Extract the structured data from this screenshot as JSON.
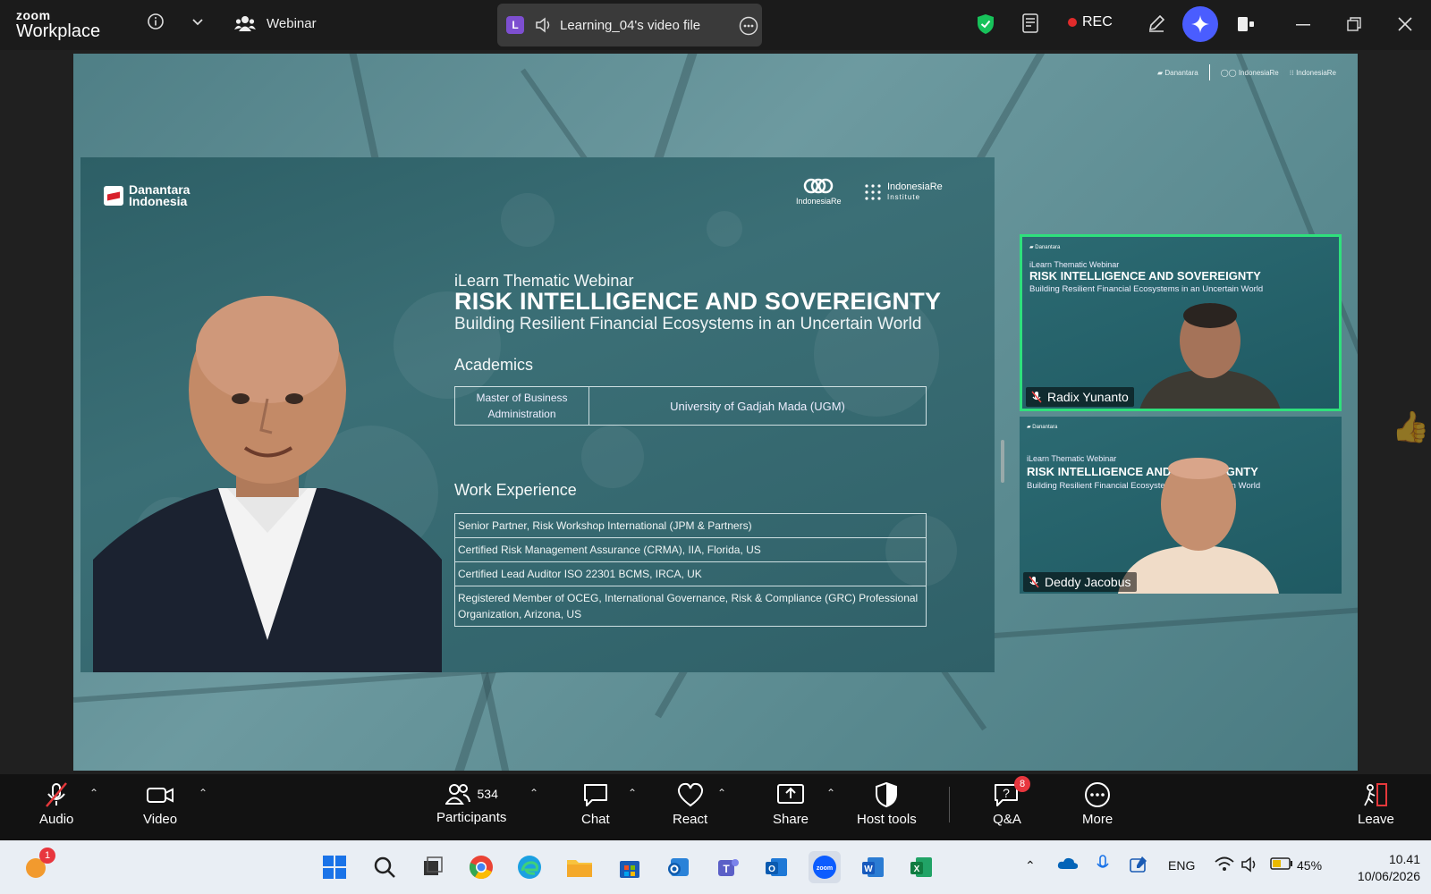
{
  "app": {
    "brand_line1": "zoom",
    "brand_line2": "Workplace",
    "mode_label": "Webinar"
  },
  "file_pill": {
    "badge": "L",
    "name": "Learning_04's video file"
  },
  "recording": {
    "label": "REC"
  },
  "slide": {
    "left_logo": [
      "Danantara",
      "Indonesia"
    ],
    "right_logo_1": "IndonesiaRe",
    "right_logo_2": "IndonesiaRe",
    "right_logo_2_sub": "Institute",
    "subtitle": "iLearn Thematic Webinar",
    "title": "RISK INTELLIGENCE AND SOVEREIGNTY",
    "tagline": "Building Resilient Financial Ecosystems in an Uncertain World",
    "academics_heading": "Academics",
    "academics": {
      "degree": "Master of Business Administration",
      "institution": "University of Gadjah Mada (UGM)"
    },
    "work_heading": "Work Experience",
    "work": [
      "Senior Partner, Risk Workshop International (JPM & Partners)",
      "Certified Risk Management Assurance (CRMA), IIA, Florida, US",
      "Certified Lead Auditor ISO 22301 BCMS, IRCA, UK",
      "Registered Member of OCEG, International Governance, Risk & Compliance (GRC) Professional Organization, Arizona, US"
    ]
  },
  "participants": [
    {
      "name": "Radix Yunanto",
      "active": true
    },
    {
      "name": "Deddy Jacobus",
      "active": false
    }
  ],
  "tile_text": {
    "sub": "iLearn Thematic Webinar",
    "title": "RISK INTELLIGENCE AND SOVEREIGNTY",
    "tag": "Building Resilient Financial Ecosystems in an Uncertain World"
  },
  "toolbar": {
    "audio": "Audio",
    "video": "Video",
    "participants": "Participants",
    "participants_count": "534",
    "chat": "Chat",
    "react": "React",
    "share": "Share",
    "host_tools": "Host tools",
    "qa": "Q&A",
    "qa_badge": "8",
    "more": "More",
    "leave": "Leave"
  },
  "taskbar": {
    "notif_badge": "1",
    "lang": "ENG",
    "battery": "45%",
    "time": "10.41",
    "date": "10/06/2026"
  },
  "colors": {
    "active_speaker": "#2fe07c",
    "rec_dot": "#e02b2b",
    "ai_button": "#4a5dff",
    "slide_bg": "#2f6068"
  }
}
